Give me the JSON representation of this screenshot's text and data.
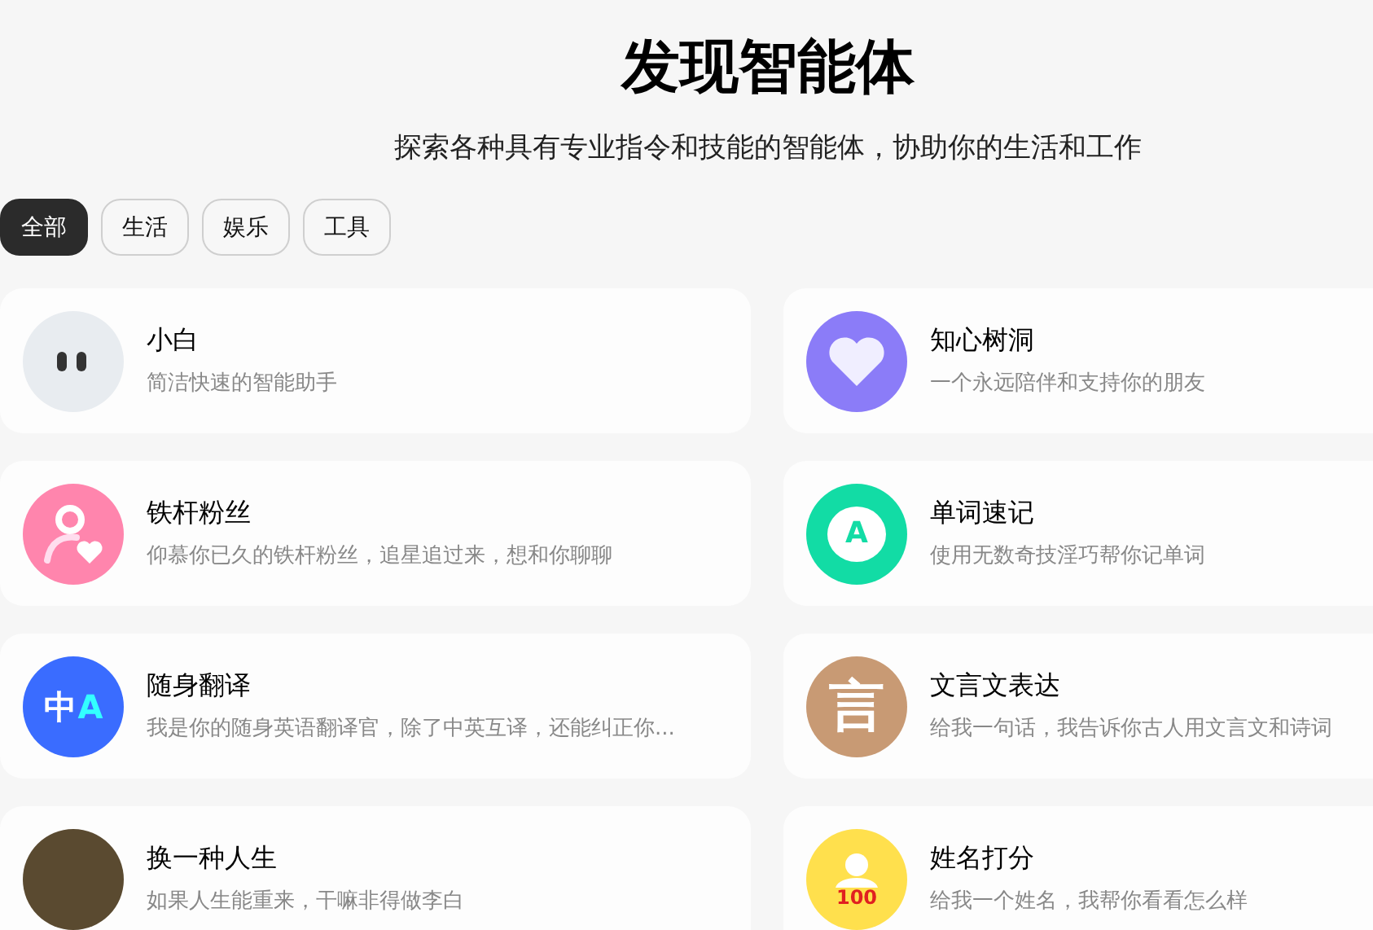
{
  "header": {
    "title": "发现智能体",
    "subtitle": "探索各种具有专业指令和技能的智能体，协助你的生活和工作"
  },
  "tabs": [
    {
      "label": "全部",
      "selected": true
    },
    {
      "label": "生活",
      "selected": false
    },
    {
      "label": "娱乐",
      "selected": false
    },
    {
      "label": "工具",
      "selected": false
    }
  ],
  "agents": [
    {
      "name": "小白",
      "description": "简洁快速的智能助手",
      "avatar": {
        "kind": "eyes",
        "color": "#e8ecf0"
      }
    },
    {
      "name": "知心树洞",
      "description": "一个永远陪伴和支持你的朋友",
      "avatar": {
        "kind": "heart",
        "color": "#8b7cf8"
      }
    },
    {
      "name": "铁杆粉丝",
      "description": "仰慕你已久的铁杆粉丝，追星追过来，想和你聊聊",
      "avatar": {
        "kind": "person-heart",
        "color": "#ff85ad"
      }
    },
    {
      "name": "单词速记",
      "description": "使用无数奇技淫巧帮你记单词",
      "avatar": {
        "kind": "bubble",
        "color": "#12dca5",
        "glyphs": [
          "A"
        ]
      }
    },
    {
      "name": "随身翻译",
      "description": "我是你的随身英语翻译官，除了中英互译，还能纠正你...",
      "avatar": {
        "kind": "translate",
        "color": "#3a6cff",
        "glyphs": [
          "中",
          "A"
        ]
      }
    },
    {
      "name": "文言文表达",
      "description": "给我一句话，我告诉你古人用文言文和诗词",
      "avatar": {
        "kind": "glyph",
        "color": "#c89a74",
        "glyphs": [
          "言"
        ]
      }
    },
    {
      "name": "换一种人生",
      "description": "如果人生能重来，干嘛非得做李白",
      "avatar": {
        "kind": "photo",
        "color": "#5a4a30"
      }
    },
    {
      "name": "姓名打分",
      "description": "给我一个姓名，我帮你看看怎么样",
      "avatar": {
        "kind": "person-score",
        "color": "#ffe04d",
        "glyphs": [
          "100"
        ]
      }
    }
  ]
}
